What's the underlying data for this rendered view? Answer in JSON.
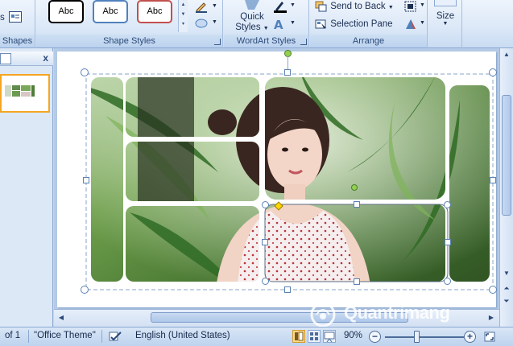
{
  "ribbon": {
    "shapes_group": {
      "label": "Shapes",
      "edge_text": "s"
    },
    "shape_styles": {
      "label": "Shape Styles",
      "swatches": [
        {
          "text": "Abc",
          "border": "#000000"
        },
        {
          "text": "Abc",
          "border": "#4f81bd"
        },
        {
          "text": "Abc",
          "border": "#c0504d"
        }
      ]
    },
    "wordart_styles": {
      "label": "WordArt Styles",
      "quick_styles_line1": "Quick",
      "quick_styles_line2": "Styles"
    },
    "arrange": {
      "label": "Arrange",
      "send_to_back": "Send to Back",
      "selection_pane": "Selection Pane"
    },
    "size": {
      "label": "Size"
    }
  },
  "thumbnail_pane": {
    "close_glyph": "x"
  },
  "statusbar": {
    "slide_indicator": "of 1",
    "theme": "\"Office Theme\"",
    "language": "English (United States)",
    "zoom": "90%",
    "zoom_out_glyph": "−",
    "zoom_in_glyph": "+"
  },
  "watermark": {
    "text": "Quantrimang"
  },
  "colors": {
    "ribbon_bg": "#dde9f8",
    "selection_handle": "#5b9bd5",
    "rotate_handle": "#92d050",
    "adjust_handle": "#ffd700",
    "thumbnail_selected": "#f5a623"
  },
  "icons": [
    "send-to-back-icon",
    "selection-pane-icon",
    "text-fill-icon",
    "text-outline-icon",
    "align-icon",
    "rotate-icon",
    "spell-check-icon",
    "fit-slide-icon"
  ]
}
